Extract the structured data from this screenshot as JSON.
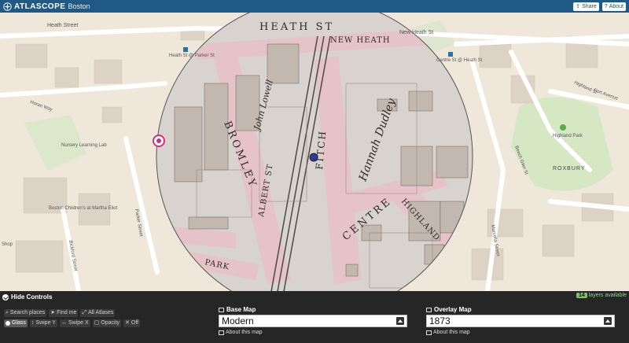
{
  "app": {
    "title": "ATLASCOPE",
    "city": "Boston",
    "share_label": "Share",
    "about_label": "About"
  },
  "map": {
    "labels": {
      "heath_street": "Heath Street",
      "new_heath_st": "New Heath St",
      "heath_st_parker": "Heath St @ Parker St",
      "centre_heath": "Centre St @ Heath St",
      "horan_way": "Horan Way",
      "nursery": "Nursery Learning Lab",
      "boston_children": "Boston Children's at Martha Eliot",
      "parker_street": "Parker Street",
      "bickford_street": "Bickford Street",
      "highland_park": "Highland Park",
      "roxbury": "ROXBURY",
      "fort_avenue": "Fort Avenue",
      "beech_glen": "Beech Glen St",
      "marcella": "Marcella Street",
      "shop": "Shop",
      "highland_st": "Highland St"
    },
    "historic_labels": {
      "heath_st": "HEATH ST",
      "new_heath": "NEW HEATH",
      "bromley": "BROMLEY",
      "centre": "CENTRE",
      "highland": "HIGHLAND",
      "albert_st": "ALBERT ST",
      "fitch": "FITCH",
      "park": "PARK",
      "hannah": "Hannah Dudley",
      "john_lowell": "John Lowell",
      "bromley_park": "BROMLEY PARK"
    }
  },
  "controls": {
    "hide_label": "Hide Controls",
    "layers_count": "14",
    "layers_text": "layers available",
    "search_label": "Search places",
    "findme_label": "Find me",
    "atlases_label": "All Atlases",
    "modes": [
      "Glass",
      "Swipe Y",
      "Swipe X",
      "Opacity",
      "Off"
    ],
    "base_map_label": "Base Map",
    "base_map_value": "Modern",
    "overlay_map_label": "Overlay Map",
    "overlay_map_value": "1873",
    "about_map": "About this map"
  },
  "colors": {
    "topbar": "#1f5a86",
    "panel": "#262626",
    "modern_bg": "#efe8da",
    "historic_bg": "#d9d3cf",
    "street_pink": "#e6c2c9"
  }
}
